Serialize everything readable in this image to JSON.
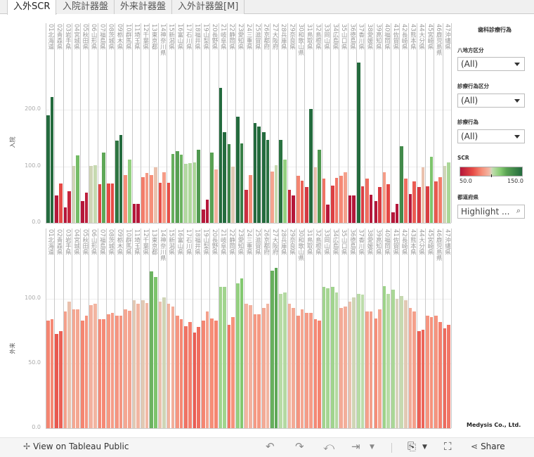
{
  "tabs": [
    {
      "label": "入外SCR",
      "active": true
    },
    {
      "label": "入院計器盤"
    },
    {
      "label": "外来計器盤"
    },
    {
      "label": "入外計器盤[M]"
    }
  ],
  "panel": {
    "title": "歯科診療行為",
    "filters": [
      {
        "label": "八地方区分",
        "value": "(All)"
      },
      {
        "label": "診療行為区分",
        "value": "(All)"
      },
      {
        "label": "診療行為",
        "value": "(All)"
      }
    ],
    "legend": {
      "title": "SCR",
      "min": "50.0",
      "max": "150.0",
      "colors": [
        "#b5173a",
        "#d9d2bc",
        "#246b3e"
      ]
    },
    "highlight": {
      "label": "都道府県",
      "placeholder": "Highlight ..."
    }
  },
  "credit": "Medysis Co., Ltd.",
  "footer": {
    "view_label": "View on Tableau Public",
    "share_label": "Share"
  },
  "chart_data": [
    {
      "type": "bar",
      "ylabel": "入院",
      "yticks": [
        "0.0",
        "100.0",
        "200.0"
      ],
      "ylim": [
        0,
        290
      ],
      "categories": [
        "01北海道",
        "02青森県",
        "03岩手県",
        "04宮城県",
        "05秋田県",
        "06山形県",
        "07福島県",
        "08茨城県",
        "09栃木県",
        "10群馬県",
        "11埼玉県",
        "12千葉県",
        "13東京都",
        "14神奈川県",
        "15新潟県",
        "16富山県",
        "17石川県",
        "18福井県",
        "19山梨県",
        "20長野県",
        "21岐阜県",
        "22静岡県",
        "23愛知県",
        "24三重県",
        "25滋賀県",
        "26京都府",
        "27大阪府",
        "28兵庫県",
        "29奈良県",
        "30和歌山県",
        "31鳥取県",
        "32島根県",
        "33岡山県",
        "34広島県",
        "35山口県",
        "36徳島県",
        "37香川県",
        "38愛媛県",
        "39高知県",
        "40福岡県",
        "41佐賀県",
        "42長崎県",
        "43熊本県",
        "44大分県",
        "45宮崎県",
        "46鹿児島県",
        "47沖縄県"
      ],
      "series": [
        {
          "values": [
            190,
            48,
            27,
            101,
            38,
            101,
            68,
            70,
            145,
            85,
            33,
            81,
            85,
            71,
            71,
            127,
            105,
            107,
            24,
            125,
            239,
            139,
            188,
            59,
            177,
            160,
            91,
            147,
            58,
            83,
            63,
            98,
            79,
            66,
            84,
            48,
            284,
            78,
            38,
            89,
            19,
            136,
            51,
            63,
            65,
            73,
            101
          ]
        },
        {
          "values": [
            223,
            70,
            56,
            119,
            53,
            102,
            124,
            70,
            155,
            112,
            34,
            88,
            98,
            89,
            122,
            121,
            106,
            130,
            41,
            95,
            160,
            99,
            141,
            85,
            171,
            147,
            102,
            112,
            49,
            75,
            202,
            130,
            32,
            80,
            90,
            48,
            65,
            50,
            64,
            69,
            34,
            78,
            74,
            98,
            117,
            81,
            107
          ]
        }
      ],
      "color_scale": {
        "min": 50,
        "max": 150,
        "mid": 100
      }
    },
    {
      "type": "bar",
      "ylabel": "外来",
      "yticks": [
        "0.0",
        "50.0",
        "100.0"
      ],
      "ylim": [
        0,
        130
      ],
      "categories": [
        "01北海道",
        "02青森県",
        "03岩手県",
        "04宮城県",
        "05秋田県",
        "06山形県",
        "07福島県",
        "08茨城県",
        "09栃木県",
        "10群馬県",
        "11埼玉県",
        "12千葉県",
        "13東京都",
        "14神奈川県",
        "15新潟県",
        "16富山県",
        "17石川県",
        "18福井県",
        "19山梨県",
        "20長野県",
        "21岐阜県",
        "22静岡県",
        "23愛知県",
        "24三重県",
        "25滋賀県",
        "26京都府",
        "27大阪府",
        "28兵庫県",
        "29奈良県",
        "30和歌山県",
        "31鳥取県",
        "32島根県",
        "33岡山県",
        "34広島県",
        "35山口県",
        "36徳島県",
        "37香川県",
        "38愛媛県",
        "39高知県",
        "40福岡県",
        "41佐賀県",
        "42長崎県",
        "43熊本県",
        "44大分県",
        "45宮崎県",
        "46鹿児島県",
        "47沖縄県"
      ],
      "series": [
        {
          "values": [
            83,
            73,
            90,
            92,
            83,
            95,
            84,
            88,
            87,
            92,
            99,
            99,
            121,
            98,
            96,
            87,
            79,
            74,
            83,
            85,
            109,
            80,
            112,
            96,
            88,
            93,
            122,
            104,
            96,
            87,
            89,
            84,
            109,
            109,
            93,
            98,
            104,
            90,
            85,
            110,
            107,
            102,
            93,
            75,
            87,
            87,
            77
          ]
        },
        {
          "values": [
            84,
            75,
            98,
            92,
            87,
            96,
            84,
            89,
            87,
            91,
            96,
            97,
            117,
            101,
            94,
            84,
            82,
            78,
            90,
            83,
            109,
            86,
            116,
            95,
            88,
            96,
            124,
            105,
            93,
            92,
            89,
            83,
            108,
            105,
            94,
            101,
            103,
            90,
            92,
            104,
            100,
            99,
            90,
            76,
            86,
            82,
            80
          ]
        }
      ],
      "color_scale": {
        "min": 50,
        "max": 150,
        "mid": 100
      }
    }
  ]
}
